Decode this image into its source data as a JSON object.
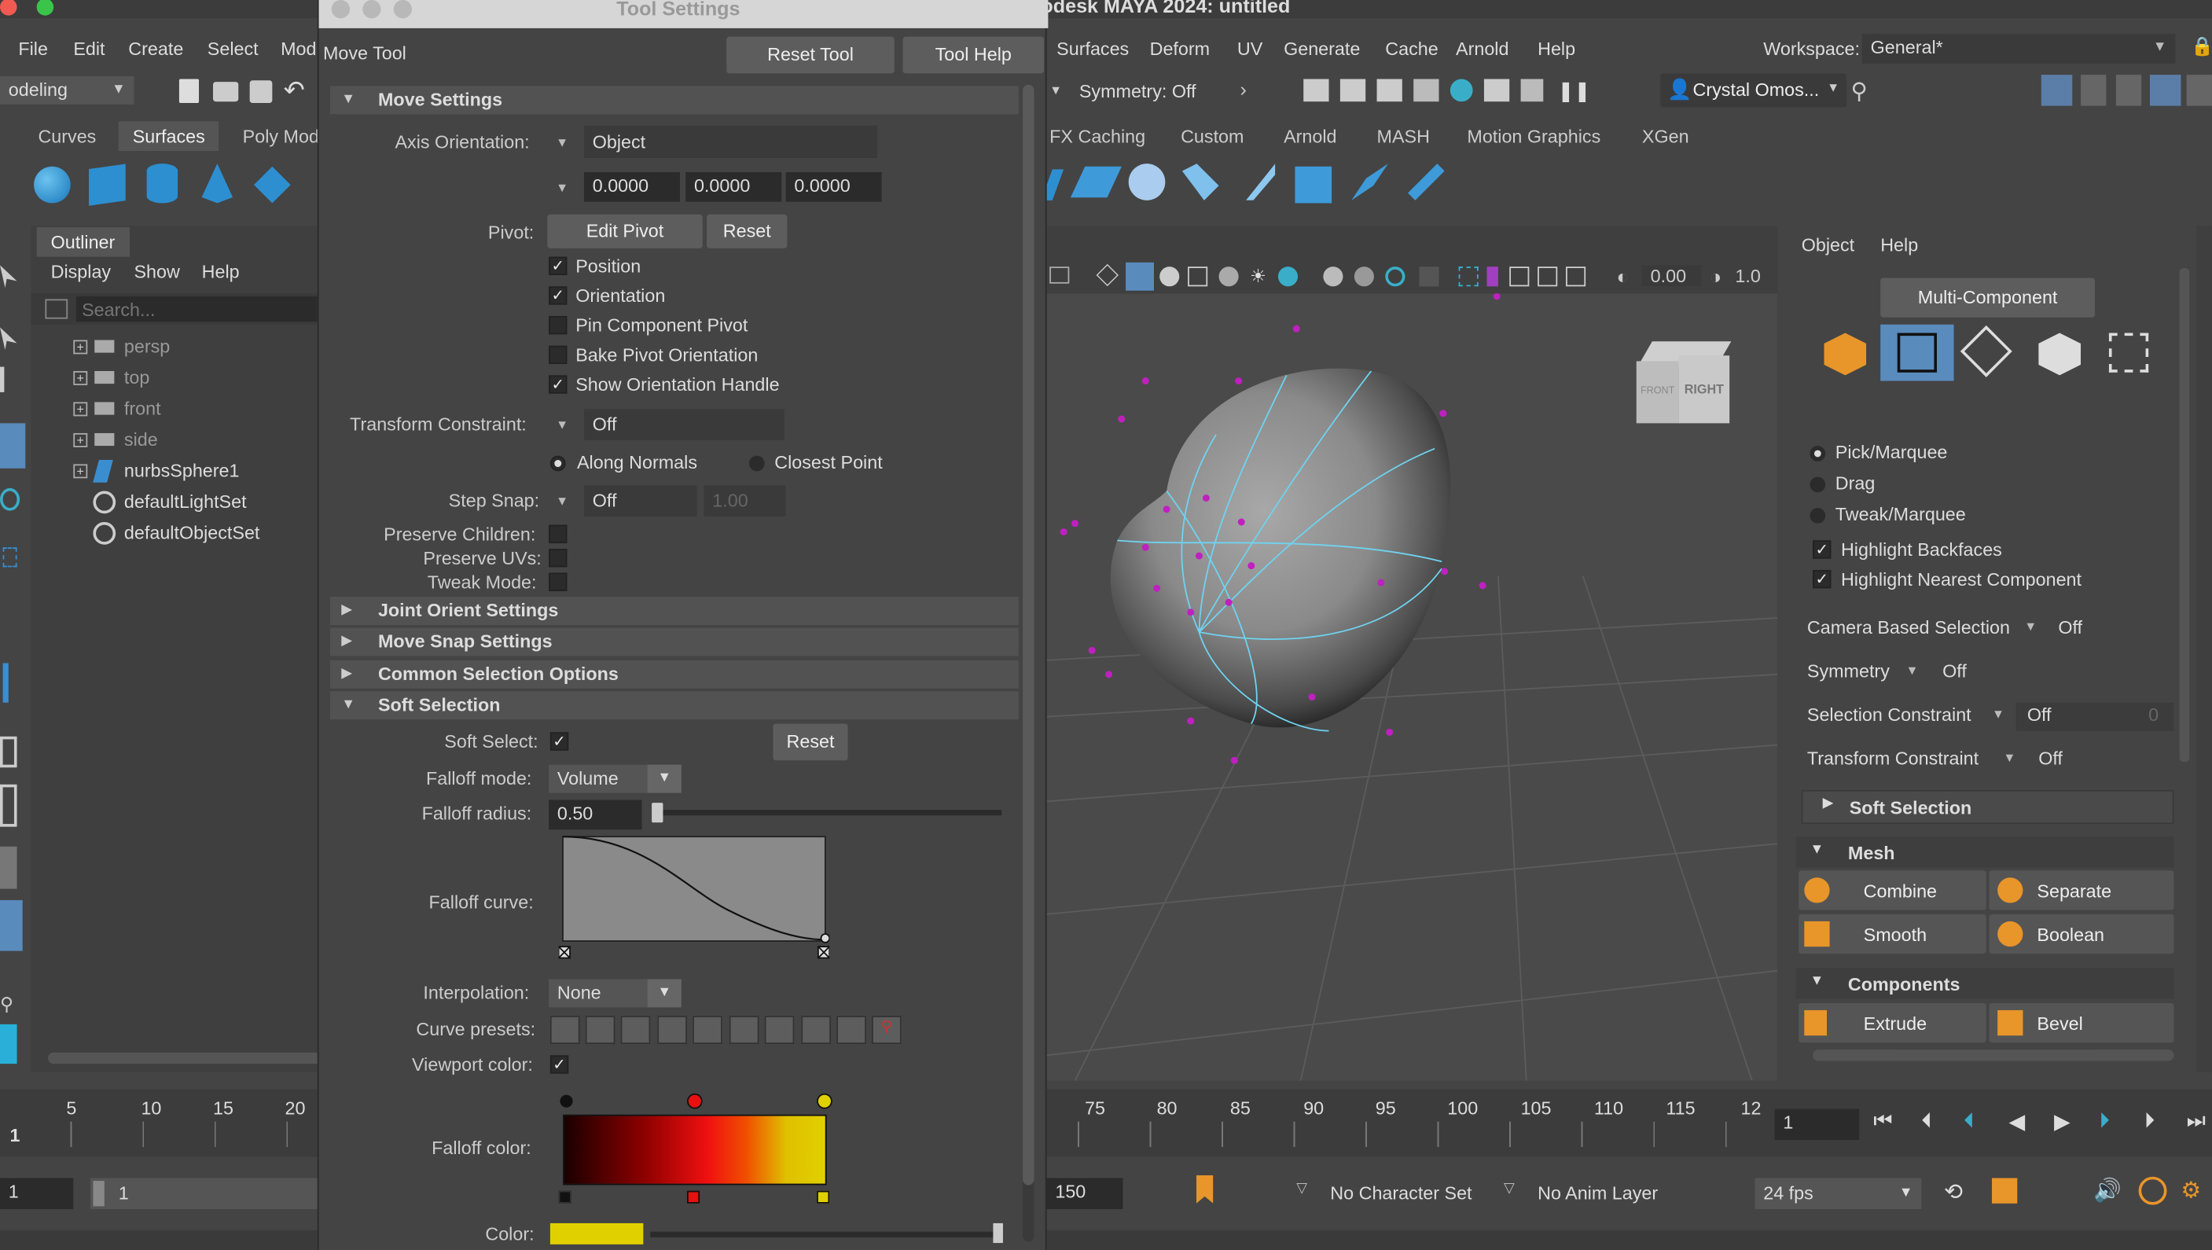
{
  "app_title": "odesk MAYA 2024: untitled",
  "main_menu": [
    "File",
    "Edit",
    "Create",
    "Select",
    "Mod"
  ],
  "right_menu": [
    "Surfaces",
    "Deform",
    "UV",
    "Generate",
    "Cache",
    "Arnold",
    "Help"
  ],
  "workspace": {
    "label": "Workspace:",
    "value": "General*"
  },
  "mode_select": "odeling",
  "symmetry": "Symmetry: Off",
  "user": "Crystal Omos...",
  "shelf_tabs_left": [
    "Curves",
    "Surfaces",
    "Poly Mod"
  ],
  "shelf_tabs_right": [
    "FX Caching",
    "Custom",
    "Arnold",
    "MASH",
    "Motion Graphics",
    "XGen"
  ],
  "outliner": {
    "tab": "Outliner",
    "menu": [
      "Display",
      "Show",
      "Help"
    ],
    "search_placeholder": "Search...",
    "items": [
      "persp",
      "top",
      "front",
      "side",
      "nurbsSphere1",
      "defaultLightSet",
      "defaultObjectSet"
    ]
  },
  "tool_settings": {
    "window_title": "Tool Settings",
    "tool_name": "Move Tool",
    "reset_tool": "Reset Tool",
    "tool_help": "Tool Help",
    "move_settings": "Move Settings",
    "axis_orientation_label": "Axis Orientation:",
    "axis_orientation_value": "Object",
    "axis_values": [
      "0.0000",
      "0.0000",
      "0.0000"
    ],
    "pivot_label": "Pivot:",
    "edit_pivot": "Edit Pivot",
    "reset": "Reset",
    "pivot_options": [
      {
        "label": "Position",
        "checked": true
      },
      {
        "label": "Orientation",
        "checked": true
      },
      {
        "label": "Pin Component Pivot",
        "checked": false
      },
      {
        "label": "Bake Pivot Orientation",
        "checked": false
      },
      {
        "label": "Show Orientation Handle",
        "checked": true
      }
    ],
    "transform_constraint_label": "Transform Constraint:",
    "transform_constraint_value": "Off",
    "along_normals": "Along Normals",
    "closest_point": "Closest Point",
    "step_snap_label": "Step Snap:",
    "step_snap_value": "Off",
    "step_snap_amount": "1.00",
    "preserve_children": "Preserve Children:",
    "preserve_uvs": "Preserve UVs:",
    "tweak_mode": "Tweak Mode:",
    "joint_orient": "Joint Orient Settings",
    "move_snap": "Move Snap Settings",
    "common_selection": "Common Selection Options",
    "soft_selection": "Soft Selection",
    "soft_select_label": "Soft Select:",
    "soft_reset": "Reset",
    "falloff_mode_label": "Falloff mode:",
    "falloff_mode_value": "Volume",
    "falloff_radius_label": "Falloff radius:",
    "falloff_radius_value": "0.50",
    "falloff_curve_label": "Falloff curve:",
    "interpolation_label": "Interpolation:",
    "interpolation_value": "None",
    "curve_presets_label": "Curve presets:",
    "viewport_color_label": "Viewport color:",
    "falloff_color_label": "Falloff color:",
    "color_label": "Color:"
  },
  "viewport": {
    "exposure": "0.00",
    "gamma": "1.0",
    "cube_front": "FRONT",
    "cube_right": "RIGHT"
  },
  "modeling_toolkit": {
    "menu": [
      "Object",
      "Help"
    ],
    "multi_component": "Multi-Component",
    "pick_marquee": "Pick/Marquee",
    "drag": "Drag",
    "tweak_marquee": "Tweak/Marquee",
    "highlight_backfaces": "Highlight Backfaces",
    "highlight_nearest": "Highlight Nearest Component",
    "rows": [
      {
        "label": "Camera Based Selection",
        "value": "Off"
      },
      {
        "label": "Symmetry",
        "value": "Off"
      },
      {
        "label": "Selection Constraint",
        "value": "Off",
        "extra": "0"
      },
      {
        "label": "Transform Constraint",
        "value": "Off"
      }
    ],
    "soft_selection": "Soft Selection",
    "mesh": "Mesh",
    "mesh_buttons": [
      "Combine",
      "Separate",
      "Smooth",
      "Boolean"
    ],
    "components": "Components",
    "component_buttons": [
      "Extrude",
      "Bevel"
    ]
  },
  "timeline": {
    "ticks_left": [
      "5",
      "10",
      "15",
      "20"
    ],
    "ticks_right": [
      "75",
      "80",
      "85",
      "90",
      "95",
      "100",
      "105",
      "110",
      "115",
      "12"
    ],
    "current_frame_left": "1",
    "current_frame": "1",
    "range_start": "1",
    "range_inner": "1",
    "range_end": "150",
    "character_set": "No Character Set",
    "anim_layer": "No Anim Layer",
    "fps": "24 fps"
  },
  "colors": {
    "accent": "#5fa8d3",
    "falloff_yellow": "#e0d000",
    "falloff_red": "#f01010",
    "component_magenta": "#c020c0"
  }
}
